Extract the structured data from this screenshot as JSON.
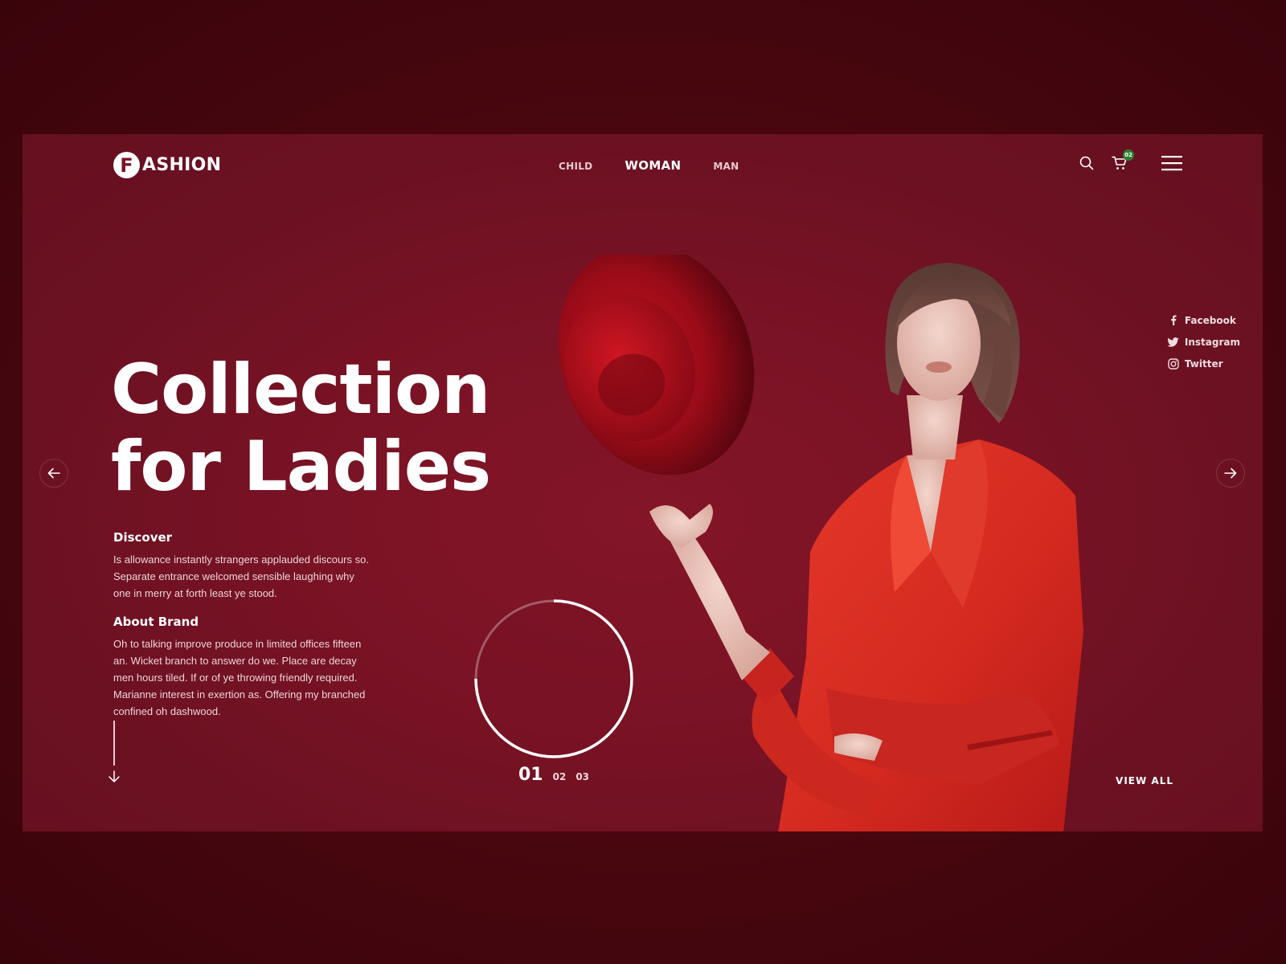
{
  "brand": {
    "mark": "F",
    "name": "ASHION"
  },
  "nav": {
    "items": [
      {
        "label": "CHILD",
        "active": false
      },
      {
        "label": "WOMAN",
        "active": true
      },
      {
        "label": "MAN",
        "active": false
      }
    ]
  },
  "header_icons": {
    "search": "search-icon",
    "cart": "cart-icon",
    "cart_count": "02",
    "menu": "hamburger-menu-icon"
  },
  "social": [
    {
      "label": "Facebook",
      "icon": "facebook-icon"
    },
    {
      "label": "Instagram",
      "icon": "twitter-bird-icon"
    },
    {
      "label": "Twitter",
      "icon": "instagram-icon"
    }
  ],
  "hero": {
    "title_line1": "Collection",
    "title_line2": "for Ladies"
  },
  "discover": {
    "heading": "Discover",
    "body": "Is allowance instantly strangers applauded discours so. Separate entrance welcomed sensible laughing why one  in merry at forth least ye stood."
  },
  "about": {
    "heading": "About Brand",
    "body": "Oh to talking improve produce in limited offices fifteen an. Wicket branch to answer do we. Place are decay men hours tiled. If or of ye throwing friendly required. Marianne interest in exertion as. Offering my branched confined oh dashwood."
  },
  "slider": {
    "pages": [
      "01",
      "02",
      "03"
    ],
    "current": "01",
    "progress_fraction": 0.75,
    "prev_icon": "arrow-left-icon",
    "next_icon": "arrow-right-icon"
  },
  "view_all_label": "VIEW ALL",
  "colors": {
    "outer_bg": "#48060f",
    "panel_bg": "#7a1325",
    "accent_red": "#d8261f",
    "badge_green": "#2f7d32",
    "text_white": "#ffffff",
    "text_muted": "#ecd3d8"
  }
}
